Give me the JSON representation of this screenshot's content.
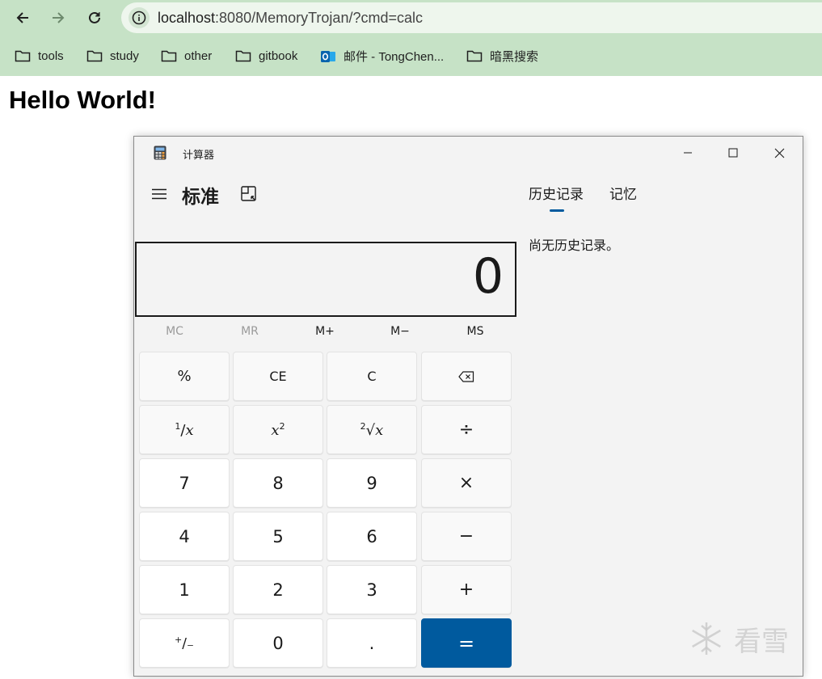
{
  "browser": {
    "url_host": "localhost",
    "url_rest": ":8080/MemoryTrojan/?cmd=calc",
    "bookmarks": [
      {
        "label": "tools",
        "icon": "folder-icon"
      },
      {
        "label": "study",
        "icon": "folder-icon"
      },
      {
        "label": "other",
        "icon": "folder-icon"
      },
      {
        "label": "gitbook",
        "icon": "folder-icon"
      },
      {
        "label": "邮件 - TongChen...",
        "icon": "outlook-icon"
      },
      {
        "label": "暗黑搜索",
        "icon": "folder-icon"
      }
    ],
    "toolbar_color": "#c6e2c6"
  },
  "page": {
    "heading": "Hello World!"
  },
  "calculator": {
    "window_title": "计算器",
    "mode_title": "标准",
    "tabs": [
      "历史记录",
      "记忆"
    ],
    "active_tab": "历史记录",
    "history_empty": "尚无历史记录。",
    "display": "0",
    "memory_buttons": [
      {
        "label": "MC",
        "enabled": false
      },
      {
        "label": "MR",
        "enabled": false
      },
      {
        "label": "M+",
        "enabled": true
      },
      {
        "label": "M−",
        "enabled": true
      },
      {
        "label": "MS",
        "enabled": true
      }
    ],
    "keys": {
      "percent": "%",
      "ce": "CE",
      "c": "C",
      "divide": "÷",
      "seven": "7",
      "eight": "8",
      "nine": "9",
      "multiply": "×",
      "four": "4",
      "five": "5",
      "six": "6",
      "minus": "−",
      "one": "1",
      "two": "2",
      "three": "3",
      "plus": "+",
      "zero": "0",
      "decimal": ".",
      "equals": "="
    },
    "accent_color": "#005a9e"
  },
  "watermark": {
    "text": "看雪"
  }
}
